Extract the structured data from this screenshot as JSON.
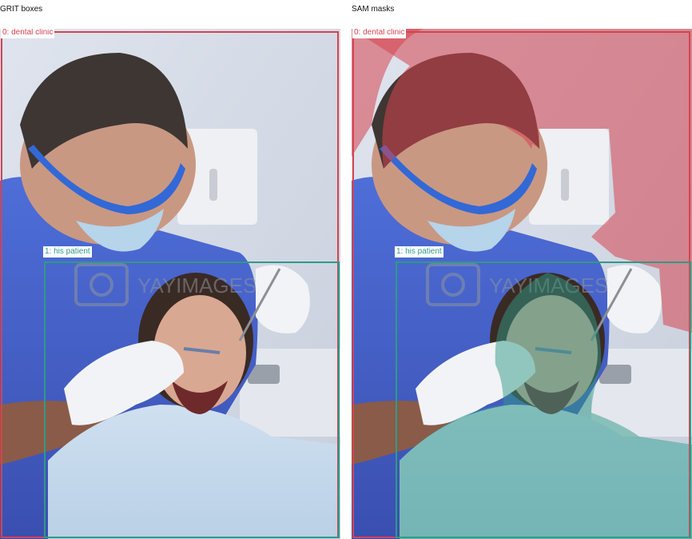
{
  "panels": {
    "left": {
      "title": "GRIT boxes"
    },
    "right": {
      "title": "SAM masks"
    }
  },
  "annotations": [
    {
      "label": "0: dental clinic",
      "color": "#d6434f"
    },
    {
      "label": "1: his patient",
      "color": "#2f9a86"
    }
  ],
  "watermark": "YAYIMAGES"
}
